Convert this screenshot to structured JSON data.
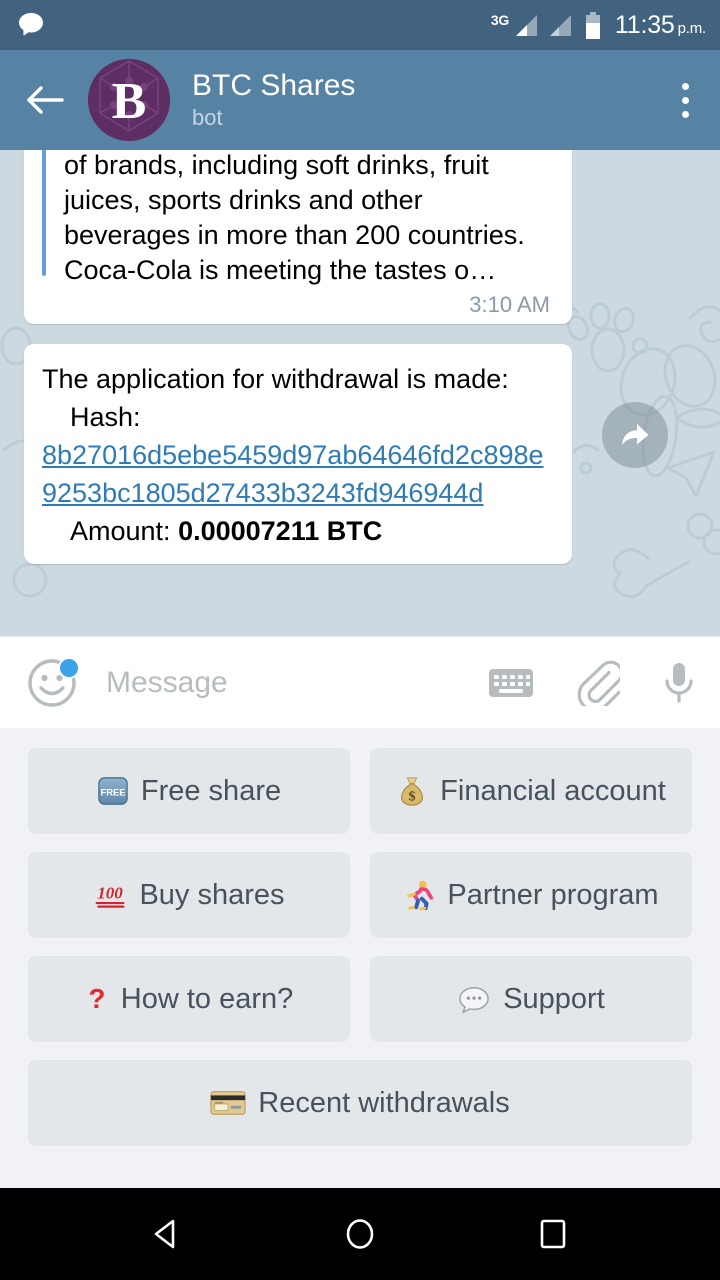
{
  "status_bar": {
    "notification_icon": "chat-bubble-icon",
    "network_type": "3G",
    "signal_icon": "signal-bars-icon",
    "battery_icon": "battery-icon",
    "time": "11:35",
    "am_pm": "p.m."
  },
  "app_bar": {
    "back_icon": "back-arrow-icon",
    "avatar_letter": "B",
    "title": "BTC Shares",
    "subtitle": "bot",
    "menu_icon": "overflow-menu-icon"
  },
  "chat": {
    "forward_icon": "forward-arrow-icon",
    "messages": [
      {
        "id": "msg-coca-cola",
        "quoted": true,
        "text": "of brands, including soft drinks, fruit juices, sports drinks and other beverages in more than 200 countries. Coca-Cola is meeting the tastes o…",
        "time": "3:10 AM"
      },
      {
        "id": "msg-withdrawal",
        "line1": "The application for withdrawal is made:",
        "hash_label": "Hash:",
        "hash_value": "8b27016d5ebe5459d97ab64646fd2c898e9253bc1805d27433b3243fd946944d",
        "amount_label": "Amount:",
        "amount_value": "0.00007211 BTC"
      }
    ]
  },
  "input_bar": {
    "emoji_icon": "smiley-face-icon",
    "emoji_badge": "new-stickers-badge",
    "placeholder": "Message",
    "value": "",
    "keyboard_icon": "keyboard-icon",
    "attach_icon": "paperclip-icon",
    "mic_icon": "microphone-icon"
  },
  "bot_keyboard": {
    "rows": [
      [
        {
          "emoji": "free-button-emoji",
          "label": "Free share"
        },
        {
          "emoji": "money-bag-emoji",
          "label": "Financial account"
        }
      ],
      [
        {
          "emoji": "hundred-points-emoji",
          "label": "Buy shares"
        },
        {
          "emoji": "runner-emoji",
          "label": "Partner program"
        }
      ],
      [
        {
          "emoji": "red-question-mark-emoji",
          "label": "How to earn?"
        },
        {
          "emoji": "speech-balloon-emoji",
          "label": "Support"
        }
      ],
      [
        {
          "emoji": "credit-card-emoji",
          "label": "Recent withdrawals"
        }
      ]
    ]
  },
  "nav_bar": {
    "back": "android-back-icon",
    "home": "android-home-icon",
    "recents": "android-recents-icon"
  },
  "colors": {
    "status_bar": "#41637f",
    "app_bar": "#5682a3",
    "chat_background": "#ccd9e1",
    "bubble": "#ffffff",
    "link": "#2f7bb5",
    "keyboard_panel": "#f0f2f5",
    "keyboard_button": "#e3e7ea",
    "avatar": "#5d2e63",
    "badge": "#3aa3e8"
  }
}
